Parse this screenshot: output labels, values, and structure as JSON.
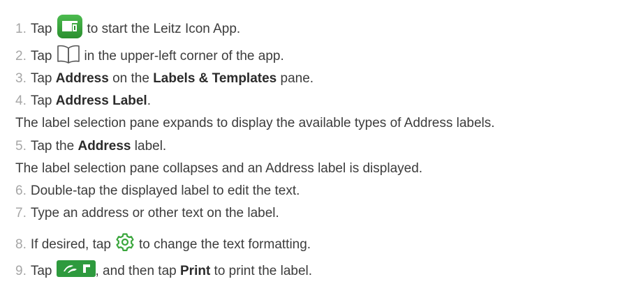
{
  "steps": [
    {
      "num": "1.",
      "pre": "Tap",
      "post": "to start the Leitz Icon App.",
      "icon": "leitz-icon-app-icon"
    },
    {
      "num": "2.",
      "pre": "Tap",
      "post": "in the upper-left corner of the app.",
      "icon": "open-book-icon"
    },
    {
      "num": "3.",
      "t1": "Tap ",
      "b1": "Address",
      "t2": " on the ",
      "b2": "Labels & Templates",
      "t3": " pane."
    },
    {
      "num": "4.",
      "t1": "Tap ",
      "b1": "Address Label",
      "t2": "."
    },
    {
      "num": "5.",
      "t1": "Tap the ",
      "b1": "Address",
      "t2": " label."
    },
    {
      "num": "6.",
      "text": "Double-tap the displayed label to edit the text."
    },
    {
      "num": "7.",
      "text": "Type an address or other text on the label."
    },
    {
      "num": "8.",
      "pre": "If desired, tap",
      "post": "to change the text formatting.",
      "icon": "gear-settings-icon"
    },
    {
      "num": "9.",
      "pre": "Tap",
      "mid": ", and then tap ",
      "bold": "Print",
      "post": " to print the label.",
      "icon": "print-icon"
    }
  ],
  "notes": {
    "step4": "The label selection pane expands to display the available types of Address labels.",
    "step5": "The label selection pane collapses and an Address label is displayed."
  },
  "colors": {
    "app_icon_green": "#3aa63c",
    "step_number": "#a6a6a6",
    "print_icon_green": "#2e9a3e"
  }
}
